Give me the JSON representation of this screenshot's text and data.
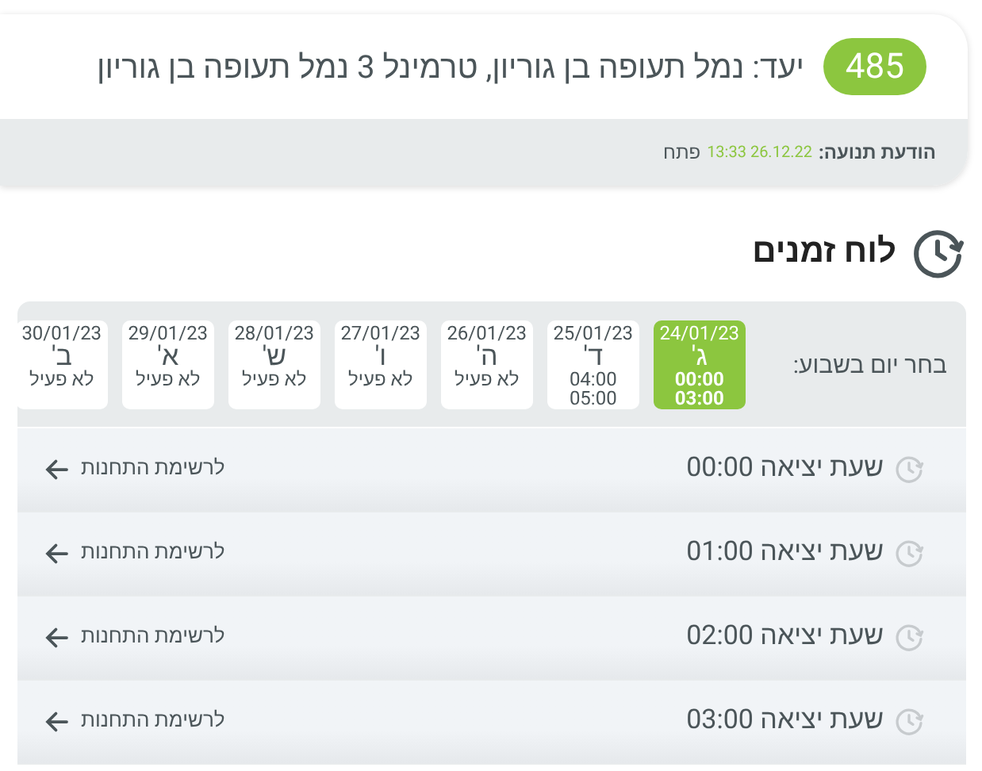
{
  "route": {
    "number": "485",
    "destination": "יעד: נמל תעופה בן גוריון, טרמינל 3 נמל תעופה בן גוריון",
    "message_label": "הודעת תנועה:",
    "message_date": "13:33 26.12.22",
    "message_link": "פתח"
  },
  "schedule": {
    "title": "לוח זמנים",
    "day_picker_label": "בחר יום בשבוע:",
    "days": [
      {
        "date": "24/01/23",
        "day": "ג'",
        "lines": [
          "00:00",
          "03:00"
        ],
        "selected": true
      },
      {
        "date": "25/01/23",
        "day": "ד'",
        "lines": [
          "04:00",
          "05:00"
        ],
        "selected": false
      },
      {
        "date": "26/01/23",
        "day": "ה'",
        "lines": [
          "לא פעיל"
        ],
        "selected": false
      },
      {
        "date": "27/01/23",
        "day": "ו'",
        "lines": [
          "לא פעיל"
        ],
        "selected": false
      },
      {
        "date": "28/01/23",
        "day": "ש'",
        "lines": [
          "לא פעיל"
        ],
        "selected": false
      },
      {
        "date": "29/01/23",
        "day": "א'",
        "lines": [
          "לא פעיל"
        ],
        "selected": false
      },
      {
        "date": "30/01/23",
        "day": "ב'",
        "lines": [
          "לא פעיל"
        ],
        "selected": false
      }
    ],
    "departures": [
      {
        "label": "שעת יציאה 00:00",
        "link": "לרשימת התחנות"
      },
      {
        "label": "שעת יציאה 01:00",
        "link": "לרשימת התחנות"
      },
      {
        "label": "שעת יציאה 02:00",
        "link": "לרשימת התחנות"
      },
      {
        "label": "שעת יציאה 03:00",
        "link": "לרשימת התחנות"
      }
    ]
  }
}
